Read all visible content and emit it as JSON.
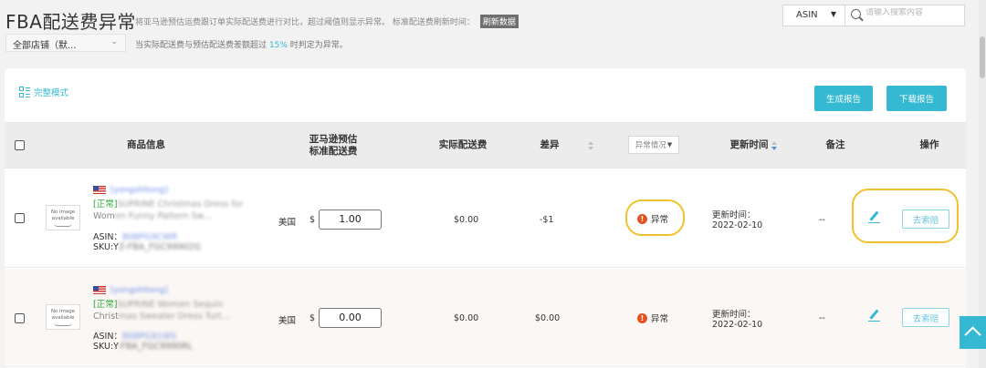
{
  "header": {
    "title": "FBA配送费异常",
    "description": "将亚马逊预估运费跟订单实际配送费进行对比，超过阈值则显示异常。 标准配送费刷新时间：",
    "refresh_label": "刷新数据",
    "store_select_value": "全部店铺（默...",
    "threshold_prefix": "当实际配送费与预估配送费差额超过",
    "threshold_pct": "15%",
    "threshold_suffix": "时判定为异常。"
  },
  "search": {
    "type_value": "ASIN",
    "placeholder": "请输入搜索内容"
  },
  "toolbar": {
    "mode_label": "完整模式",
    "report_label": "生成报告",
    "download_label": "下载报告"
  },
  "table": {
    "columns": {
      "product": "商品信息",
      "estimated_line1": "亚马逊预估",
      "estimated_line2": "标准配送费",
      "actual": "实际配送费",
      "diff": "差异",
      "status_filter": "异常情况",
      "updated": "更新时间",
      "notes": "备注",
      "actions": "操作"
    },
    "rows": [
      {
        "image_text_1": "No image",
        "image_text_2": "available",
        "store": "[yongshitong]",
        "tag": "[正常]",
        "title_blur": "SUPRINE Christmas Dress for",
        "title_line2_visible": "Wom",
        "title_line2_blur": "en Funny Pattern Sw...",
        "asin_label": "ASIN：",
        "asin_value": "B08PG9CWR",
        "sku_label": "SKU:Y",
        "sku_value": "Z-FBA_FGC99902G",
        "country": "美国",
        "currency": "$",
        "estimated": "1.00",
        "actual": "$0.00",
        "diff": "-$1",
        "status": "异常",
        "updated_label": "更新时间：",
        "updated_date": "2022-02-10",
        "notes": "--",
        "claim_label": "去索赔"
      },
      {
        "image_text_1": "No image",
        "image_text_2": "available",
        "store": "[yongshitong]",
        "tag": "[正常]",
        "title_blur": "SUPRINE Women Sequin",
        "title_line2_visible": "Christ",
        "title_line2_blur": "mas Sweater Dress Turt...",
        "asin_label": "ASIN：",
        "asin_value": "B08PG91WS",
        "sku_label": "SKU:Y",
        "sku_value": "-FBA_FGC9990RL",
        "country": "美国",
        "currency": "$",
        "estimated": "0.00",
        "actual": "$0.00",
        "diff": "$0.00",
        "status": "异常",
        "updated_label": "更新时间：",
        "updated_date": "2022-02-10",
        "notes": "--",
        "claim_label": "去索赔"
      }
    ]
  },
  "colors": {
    "accent": "#35b8d2",
    "alert": "#e6521f",
    "highlight": "#f2c12e",
    "normal_tag": "#2aa637"
  }
}
